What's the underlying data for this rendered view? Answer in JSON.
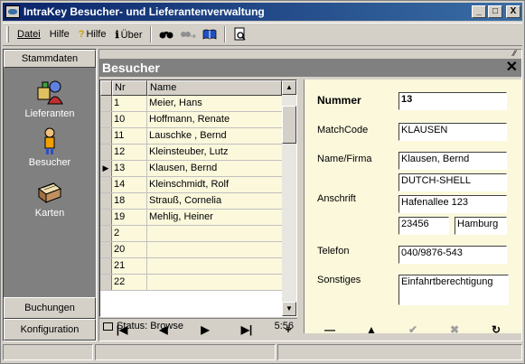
{
  "window": {
    "title": "IntraKey Besucher- und Lieferantenverwaltung",
    "controls": {
      "minimize": "_",
      "maximize": "□",
      "close": "X"
    }
  },
  "menu": {
    "items": [
      {
        "label": "Datei",
        "icon": ""
      },
      {
        "label": "Hilfe",
        "icon": ""
      },
      {
        "label": "Hilfe",
        "icon": "question-icon"
      },
      {
        "label": "Über",
        "icon": "info-icon"
      }
    ],
    "tools": [
      "binoculars-icon",
      "forward-search-icon",
      "book-icon",
      "preview-icon"
    ]
  },
  "sidebar": {
    "header": "Stammdaten",
    "entries": [
      {
        "label": "Lieferanten",
        "icon": "supplier-icon"
      },
      {
        "label": "Besucher",
        "icon": "visitor-icon"
      },
      {
        "label": "Karten",
        "icon": "cards-icon"
      }
    ],
    "footer": [
      "Buchungen",
      "Konfiguration"
    ]
  },
  "panel": {
    "title": "Besucher",
    "grid": {
      "columns": [
        "Nr",
        "Name"
      ],
      "rows": [
        {
          "nr": "1",
          "name": "Meier, Hans",
          "current": false
        },
        {
          "nr": "10",
          "name": "Hoffmann, Renate",
          "current": false
        },
        {
          "nr": "11",
          "name": "Lauschke , Bernd",
          "current": false
        },
        {
          "nr": "12",
          "name": "Kleinsteuber, Lutz",
          "current": false
        },
        {
          "nr": "13",
          "name": "Klausen, Bernd",
          "current": true
        },
        {
          "nr": "14",
          "name": "Kleinschmidt, Rolf",
          "current": false
        },
        {
          "nr": "18",
          "name": "Strauß, Cornelia",
          "current": false
        },
        {
          "nr": "19",
          "name": "Mehlig, Heiner",
          "current": false
        },
        {
          "nr": "2",
          "name": "",
          "current": false
        },
        {
          "nr": "20",
          "name": "",
          "current": false
        },
        {
          "nr": "21",
          "name": "",
          "current": false
        },
        {
          "nr": "22",
          "name": "",
          "current": false
        }
      ],
      "status": "Status: Browse",
      "time": "5:56"
    },
    "form": {
      "nummer_label": "Nummer",
      "nummer": "13",
      "matchcode_label": "MatchCode",
      "matchcode": "KLAUSEN",
      "name_label": "Name/Firma",
      "name1": "Klausen, Bernd",
      "name2": "DUTCH-SHELL",
      "anschrift_label": "Anschrift",
      "strasse": "Hafenallee 123",
      "plz": "23456",
      "ort": "Hamburg",
      "telefon_label": "Telefon",
      "telefon": "040/9876-543",
      "sonstiges_label": "Sonstiges",
      "sonstiges": "Einfahrtberechtigung"
    }
  },
  "navigator": [
    {
      "name": "first-record-button",
      "glyph": "|◀",
      "disabled": false
    },
    {
      "name": "prior-record-button",
      "glyph": "◀",
      "disabled": false
    },
    {
      "name": "next-record-button",
      "glyph": "▶",
      "disabled": false
    },
    {
      "name": "last-record-button",
      "glyph": "▶|",
      "disabled": false
    },
    {
      "name": "insert-record-button",
      "glyph": "+",
      "disabled": false
    },
    {
      "name": "delete-record-button",
      "glyph": "—",
      "disabled": false
    },
    {
      "name": "edit-record-button",
      "glyph": "▲",
      "disabled": false
    },
    {
      "name": "post-record-button",
      "glyph": "✔",
      "disabled": true
    },
    {
      "name": "cancel-record-button",
      "glyph": "✖",
      "disabled": true
    },
    {
      "name": "refresh-record-button",
      "glyph": "↻",
      "disabled": false
    }
  ],
  "colors": {
    "title_start": "#0a246a",
    "title_end": "#3a6ea5",
    "row_bg": "#fbf8dc",
    "sidebar_bg": "#808080"
  }
}
